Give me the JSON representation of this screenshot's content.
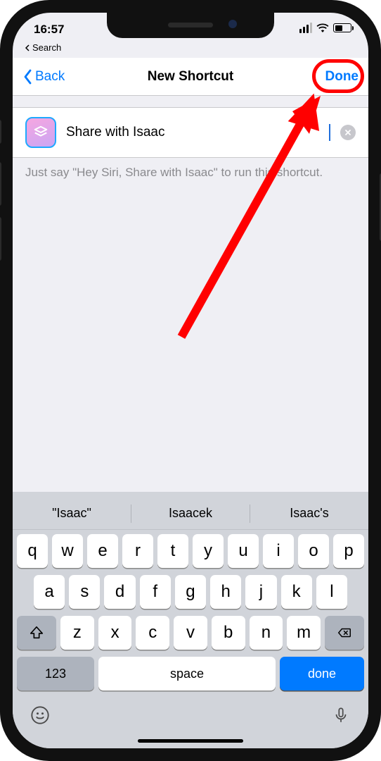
{
  "status": {
    "time": "16:57",
    "back_app_label": "Search"
  },
  "nav": {
    "back_label": "Back",
    "title": "New Shortcut",
    "done_label": "Done"
  },
  "shortcut": {
    "name_value": "Share with Isaac"
  },
  "hint": {
    "text": "Just say \"Hey Siri, Share with Isaac\" to run this shortcut."
  },
  "predictions": {
    "p1": "\"Isaac\"",
    "p2": "Isaacek",
    "p3": "Isaac's"
  },
  "keys": {
    "row1": [
      "q",
      "w",
      "e",
      "r",
      "t",
      "y",
      "u",
      "i",
      "o",
      "p"
    ],
    "row2": [
      "a",
      "s",
      "d",
      "f",
      "g",
      "h",
      "j",
      "k",
      "l"
    ],
    "row3": [
      "z",
      "x",
      "c",
      "v",
      "b",
      "n",
      "m"
    ],
    "num_label": "123",
    "space_label": "space",
    "done_label": "done"
  }
}
